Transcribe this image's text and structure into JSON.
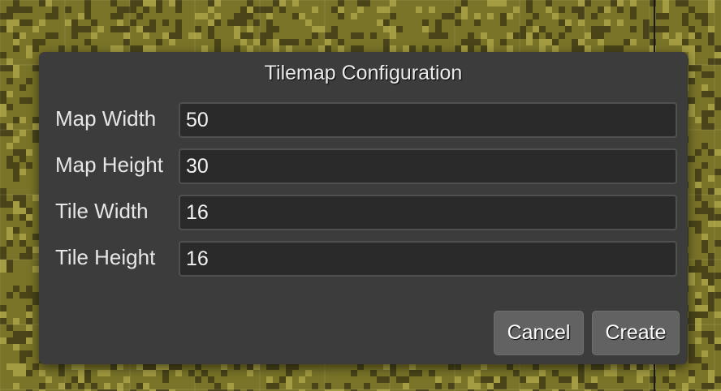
{
  "dialog": {
    "title": "Tilemap Configuration",
    "fields": [
      {
        "label": "Map Width",
        "value": "50"
      },
      {
        "label": "Map Height",
        "value": "30"
      },
      {
        "label": "Tile Width",
        "value": "16"
      },
      {
        "label": "Tile Height",
        "value": "16"
      }
    ],
    "buttons": {
      "cancel_label": "Cancel",
      "create_label": "Create"
    }
  },
  "colors": {
    "backdrop_base": "#7a7428",
    "backdrop_dark": "#4a4418",
    "backdrop_light": "#a39c42",
    "dialog_bg": "#3c3c3c",
    "input_bg": "#2a2a2a",
    "button_bg": "#626262"
  }
}
